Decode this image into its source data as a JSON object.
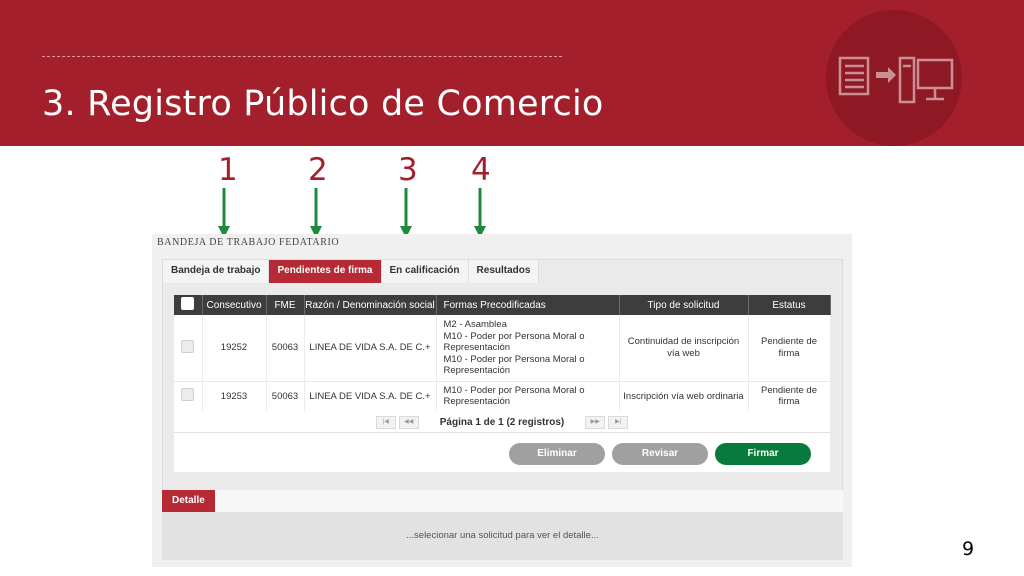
{
  "slide": {
    "title": "3. Registro Público de Comercio",
    "page_number": "9",
    "steps": [
      "1",
      "2",
      "3",
      "4"
    ],
    "colors": {
      "brand_red": "#a31f2b",
      "arrow_green": "#1f8a3c",
      "firmar_green": "#087a3c"
    }
  },
  "app": {
    "title": "BANDEJA DE TRABAJO FEDATARIO",
    "tabs": [
      {
        "label": "Bandeja de trabajo",
        "active": false
      },
      {
        "label": "Pendientes de firma",
        "active": true
      },
      {
        "label": "En calificación",
        "active": false
      },
      {
        "label": "Resultados",
        "active": false
      }
    ],
    "grid": {
      "columns": [
        "Consecutivo",
        "FME",
        "Razón / Denominación social",
        "Formas Precodificadas",
        "Tipo de solicitud",
        "Estatus"
      ],
      "rows": [
        {
          "consecutivo": "19252",
          "fme": "50063",
          "razon": "LINEA DE VIDA S.A. DE C.+",
          "formas": [
            "M2 - Asamblea",
            "M10 - Poder por Persona Moral o",
            "Representación",
            "M10 - Poder por Persona Moral o",
            "Representación"
          ],
          "tipo": [
            "Continuidad de inscripción",
            "vía web"
          ],
          "estatus": [
            "Pendiente de",
            "firma"
          ]
        },
        {
          "consecutivo": "19253",
          "fme": "50063",
          "razon": "LINEA DE VIDA S.A. DE C.+",
          "formas": [
            "M10 - Poder por Persona Moral o",
            "Representación"
          ],
          "tipo": [
            "Inscripción vía web ordinaria"
          ],
          "estatus": [
            "Pendiente de",
            "firma"
          ]
        }
      ]
    },
    "pager": {
      "text": "Página 1 de 1 (2 registros)",
      "first": "|◀",
      "prev": "◀◀",
      "next": "▶▶",
      "last": "▶|"
    },
    "buttons": {
      "eliminar": "Eliminar",
      "revisar": "Revisar",
      "firmar": "Firmar"
    },
    "detail": {
      "tab": "Detalle",
      "message": "...selecionar una solicitud para ver el detalle..."
    }
  }
}
